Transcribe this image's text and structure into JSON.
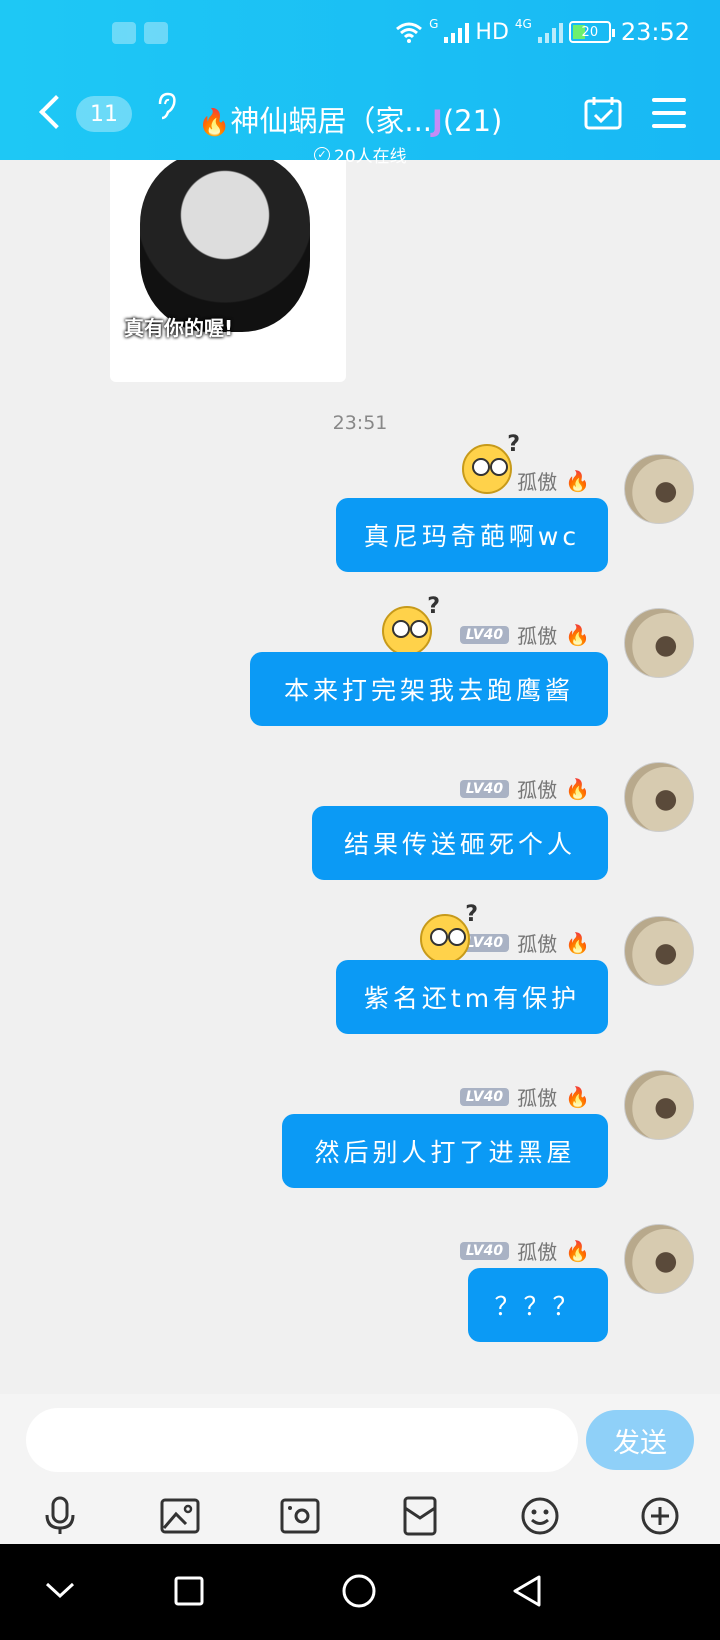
{
  "status_bar": {
    "network_g": "G",
    "hd": "HD",
    "network_4g": "4G",
    "battery": "20",
    "time": "23:52"
  },
  "header": {
    "unread_count": "11",
    "group_name": "神仙蜗居（家...",
    "group_count": "(21)",
    "online_status": "20人在线"
  },
  "sticker_caption": "真有你的喔!",
  "timestamp": "23:51",
  "sender": {
    "name": "孤傲",
    "level": "LV40"
  },
  "messages": [
    {
      "text": "真尼玛奇葩啊wc"
    },
    {
      "text": "本来打完架我去跑鹰酱"
    },
    {
      "text": "结果传送砸死个人"
    },
    {
      "text": "紫名还tm有保护"
    },
    {
      "text": "然后别人打了进黑屋"
    },
    {
      "text": "？？？"
    }
  ],
  "input": {
    "value": "",
    "send_label": "发送"
  },
  "colors": {
    "header": "#1ec8f5",
    "bubble": "#0b9af5",
    "send": "#8fd0f8"
  }
}
